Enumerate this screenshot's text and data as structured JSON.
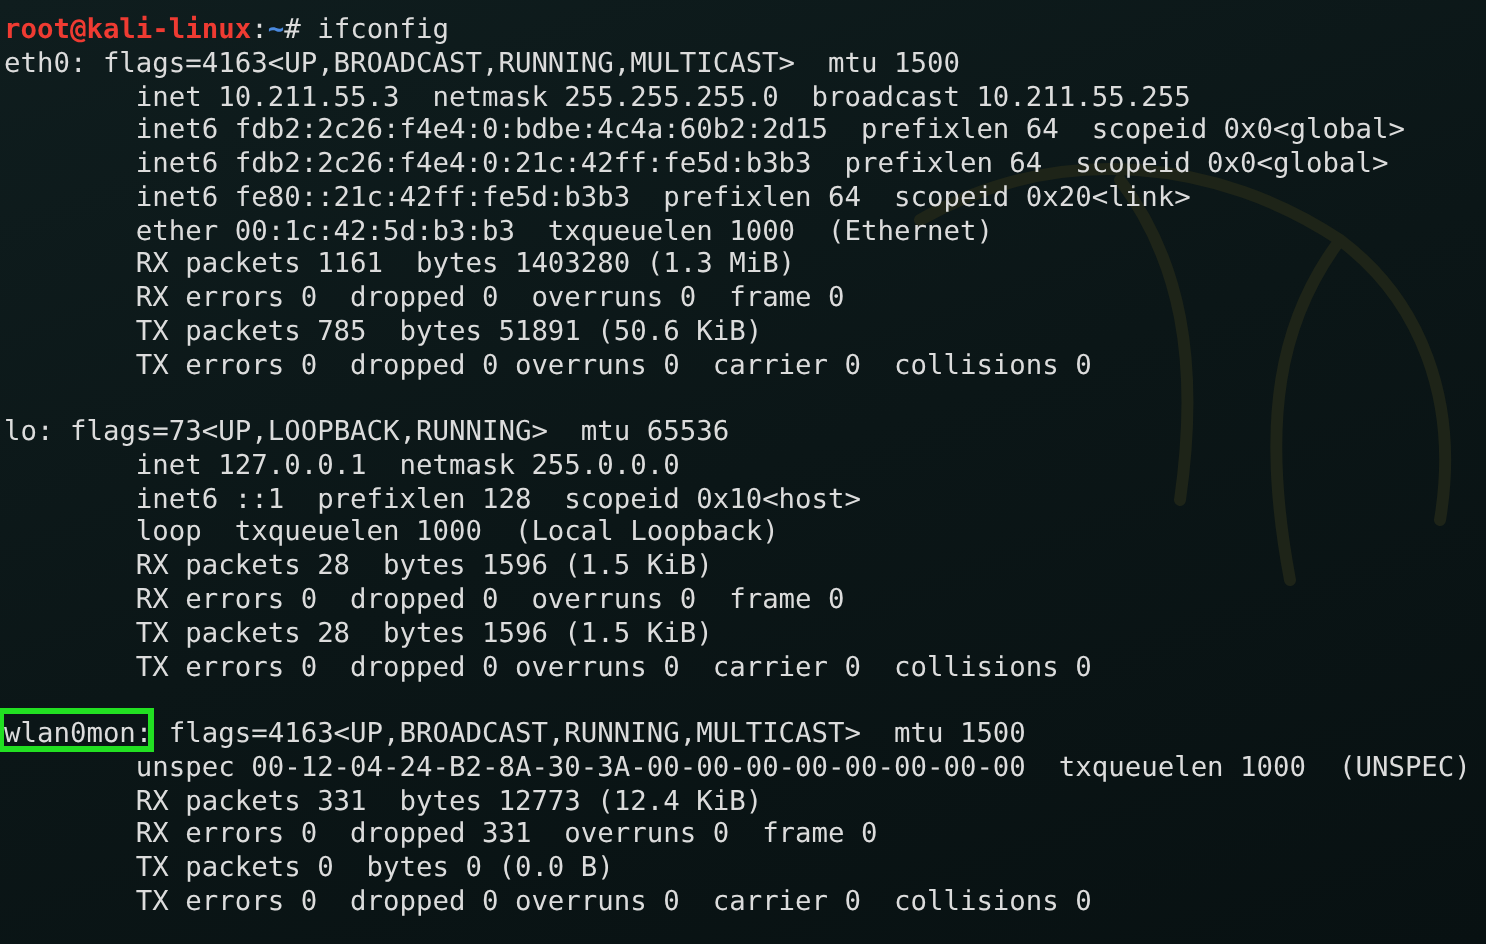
{
  "prompt": {
    "user_host": "root@kali-linux",
    "separator": ":",
    "path": "~",
    "symbol": "#",
    "command": "ifconfig"
  },
  "interfaces": [
    {
      "name": "eth0:",
      "highlighted": false,
      "header": "flags=4163<UP,BROADCAST,RUNNING,MULTICAST>  mtu 1500",
      "lines": [
        "inet 10.211.55.3  netmask 255.255.255.0  broadcast 10.211.55.255",
        "inet6 fdb2:2c26:f4e4:0:bdbe:4c4a:60b2:2d15  prefixlen 64  scopeid 0x0<global>",
        "inet6 fdb2:2c26:f4e4:0:21c:42ff:fe5d:b3b3  prefixlen 64  scopeid 0x0<global>",
        "inet6 fe80::21c:42ff:fe5d:b3b3  prefixlen 64  scopeid 0x20<link>",
        "ether 00:1c:42:5d:b3:b3  txqueuelen 1000  (Ethernet)",
        "RX packets 1161  bytes 1403280 (1.3 MiB)",
        "RX errors 0  dropped 0  overruns 0  frame 0",
        "TX packets 785  bytes 51891 (50.6 KiB)",
        "TX errors 0  dropped 0 overruns 0  carrier 0  collisions 0"
      ]
    },
    {
      "name": "lo:",
      "highlighted": false,
      "header": "flags=73<UP,LOOPBACK,RUNNING>  mtu 65536",
      "lines": [
        "inet 127.0.0.1  netmask 255.0.0.0",
        "inet6 ::1  prefixlen 128  scopeid 0x10<host>",
        "loop  txqueuelen 1000  (Local Loopback)",
        "RX packets 28  bytes 1596 (1.5 KiB)",
        "RX errors 0  dropped 0  overruns 0  frame 0",
        "TX packets 28  bytes 1596 (1.5 KiB)",
        "TX errors 0  dropped 0 overruns 0  carrier 0  collisions 0"
      ]
    },
    {
      "name": "wlan0mon:",
      "highlighted": true,
      "header": "flags=4163<UP,BROADCAST,RUNNING,MULTICAST>  mtu 1500",
      "lines": [
        "unspec 00-12-04-24-B2-8A-30-3A-00-00-00-00-00-00-00-00  txqueuelen 1000  (UNSPEC)",
        "RX packets 331  bytes 12773 (12.4 KiB)",
        "RX errors 0  dropped 331  overruns 0  frame 0",
        "TX packets 0  bytes 0 (0.0 B)",
        "TX errors 0  dropped 0 overruns 0  carrier 0  collisions 0"
      ]
    }
  ]
}
